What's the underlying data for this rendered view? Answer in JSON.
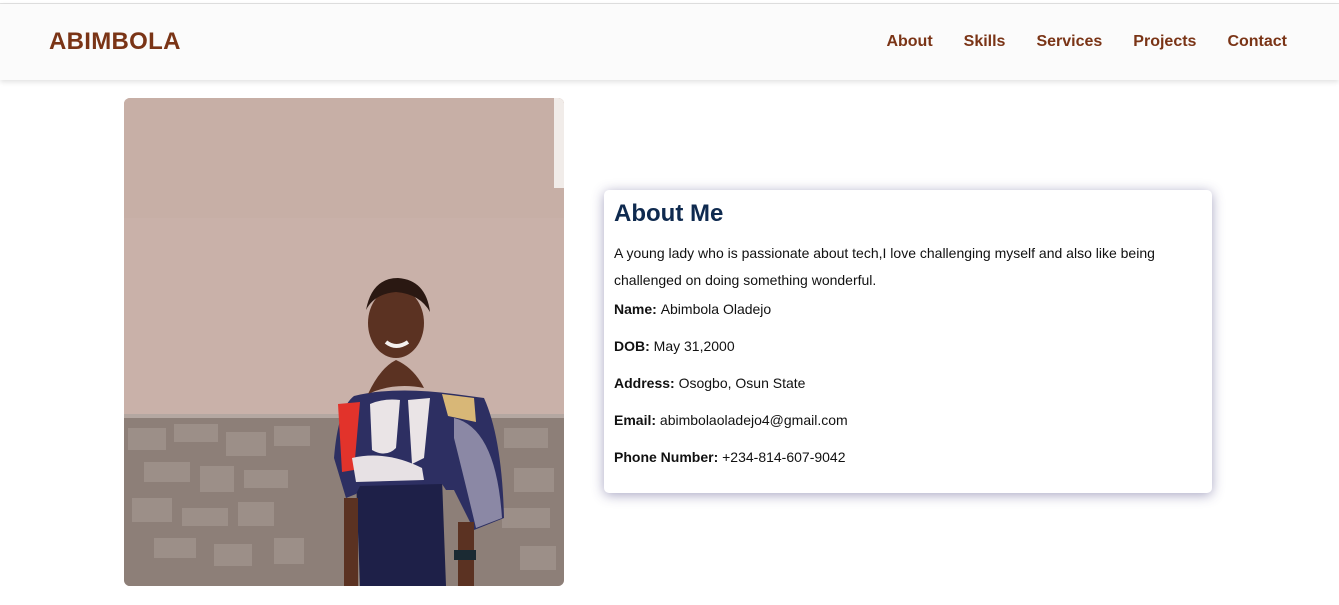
{
  "header": {
    "brand": "ABIMBOLA",
    "nav": [
      {
        "label": "About"
      },
      {
        "label": "Skills"
      },
      {
        "label": "Services"
      },
      {
        "label": "Projects"
      },
      {
        "label": "Contact"
      }
    ]
  },
  "about": {
    "title": "About Me",
    "bio": "A young lady who is passionate about tech,I love challenging myself and also like being challenged on doing something wonderful.",
    "details": [
      {
        "label": "Name:",
        "value": "Abimbola Oladejo"
      },
      {
        "label": "DOB:",
        "value": "May 31,2000"
      },
      {
        "label": "Address:",
        "value": "Osogbo, Osun State"
      },
      {
        "label": "Email:",
        "value": "abimbolaoladejo4@gmail.com"
      },
      {
        "label": "Phone Number:",
        "value": "+234-814-607-9042"
      }
    ]
  },
  "colors": {
    "brand": "#7a3416",
    "title": "#0f2a4f"
  }
}
